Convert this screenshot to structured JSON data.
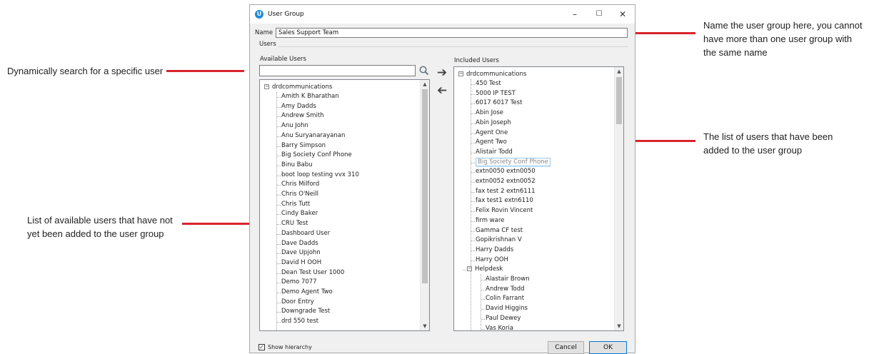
{
  "annotations": {
    "name_note": [
      "Name the user group here, you cannot",
      "have more than one user group with",
      "the same name"
    ],
    "search_note": "Dynamically search for a specific user",
    "included_note": [
      "The list of users that have been",
      "added to the user group"
    ],
    "available_note": [
      "List of available users that have not",
      "yet been added to the user group"
    ]
  },
  "accent_color": "#d9242c",
  "window": {
    "title": "User Group",
    "minimize": "–",
    "maximize": "☐",
    "close": "✕"
  },
  "form": {
    "name_label": "Name",
    "name_value": "Sales Support Team",
    "users_label": "Users",
    "available_label": "Available Users",
    "included_label": "Included Users",
    "search_value": ""
  },
  "available": {
    "root": "drdcommunications",
    "items": [
      "Amith K Bharathan",
      "Amy Dadds",
      "Andrew Smith",
      "Anu John",
      "Anu Suryanarayanan",
      "Barry Simpson",
      "Big Society Conf Phone",
      "Binu Babu",
      "boot loop testing vvx 310",
      "Chris Milford",
      "Chris O'Neill",
      "Chris Tutt",
      "Cindy Baker",
      "CRU Test",
      "Dashboard User",
      "Dave Dadds",
      "Dave Upjohn",
      "David H OOH",
      "Dean Test User 1000",
      "Demo 7077",
      "Demo Agent Two",
      "Door Entry",
      "Downgrade Test",
      "drd 550 test"
    ]
  },
  "included": {
    "root": "drdcommunications",
    "items": [
      "450 Test",
      "5000 IP TEST",
      "6017 6017 Test",
      "Abin Jose",
      "Abin Joseph",
      "Agent One",
      "Agent Two",
      "Alistair Todd",
      "Big Society Conf Phone",
      "extn0050 extn0050",
      "extn0052 extn0052",
      "fax test 2 extn6111",
      "fax test1 extn6110",
      "Felix Rovin Vincent",
      "firm ware",
      "Gamma CF test",
      "Gopikrishnan V",
      "Harry Dadds",
      "Harry OOH"
    ],
    "group": "Helpdesk",
    "group_items": [
      "Alastair Brown",
      "Andrew Todd",
      "Colin Farrant",
      "David Higgins",
      "Paul Dewey",
      "Vas Koria"
    ]
  },
  "footer": {
    "show_hierarchy": "Show hierarchy",
    "cancel": "Cancel",
    "ok": "OK"
  }
}
